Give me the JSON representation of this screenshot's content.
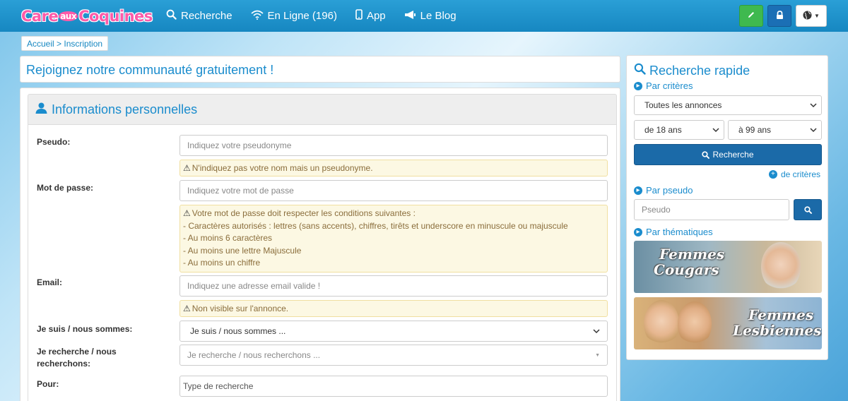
{
  "brand": {
    "logo": "Care",
    "logo_mid": "aux",
    "logo_end": "Coquines"
  },
  "nav": {
    "search": "Recherche",
    "online": "En Ligne (196)",
    "app": "App",
    "blog": "Le Blog"
  },
  "breadcrumb": "Accueil > Inscription",
  "page_title": "Rejoignez notre communauté gratuitement !",
  "panel": {
    "title": "Informations personnelles"
  },
  "form": {
    "pseudo_label": "Pseudo:",
    "pseudo_placeholder": "Indiquez votre pseudonyme",
    "pseudo_warning": "N'indiquez pas votre nom mais un pseudonyme.",
    "password_label": "Mot de passe:",
    "password_placeholder": "Indiquez votre mot de passe",
    "password_rules": [
      "Votre mot de passe doit respecter les conditions suivantes :",
      "- Caractères autorisés : lettres (sans accents), chiffres, tirêts et underscore en minuscule ou majuscule",
      "- Au moins 6 caractères",
      "- Au moins une lettre Majuscule",
      "- Au moins un chiffre"
    ],
    "email_label": "Email:",
    "email_placeholder": "Indiquez une adresse email valide !",
    "email_warning": "Non visible sur l'annonce.",
    "iam_label": "Je suis / nous sommes:",
    "iam_value": "Je suis / nous sommes ...",
    "seek_label_1": "Je recherche / nous",
    "seek_label_2": "recherchons:",
    "seek_value": "Je recherche / nous recherchons ...",
    "for_label": "Pour:",
    "for_placeholder": "Type de recherche"
  },
  "sidebar": {
    "title": "Recherche rapide",
    "by_criteria": "Par critères",
    "ads_select": "Toutes les annonces",
    "age_from": "de 18 ans",
    "age_to": "à 99 ans",
    "search_button": "Recherche",
    "more_criteria": "de critères",
    "by_pseudo": "Par pseudo",
    "pseudo_placeholder": "Pseudo",
    "by_theme": "Par thématiques",
    "theme1_line1": "Femmes",
    "theme1_line2": "Cougars",
    "theme2_line1": "Femmes",
    "theme2_line2": "Lesbiennes"
  },
  "colors": {
    "accent": "#1a8ccd",
    "nav_bg": "#1687c1",
    "warn_bg": "#fcf8e3"
  }
}
